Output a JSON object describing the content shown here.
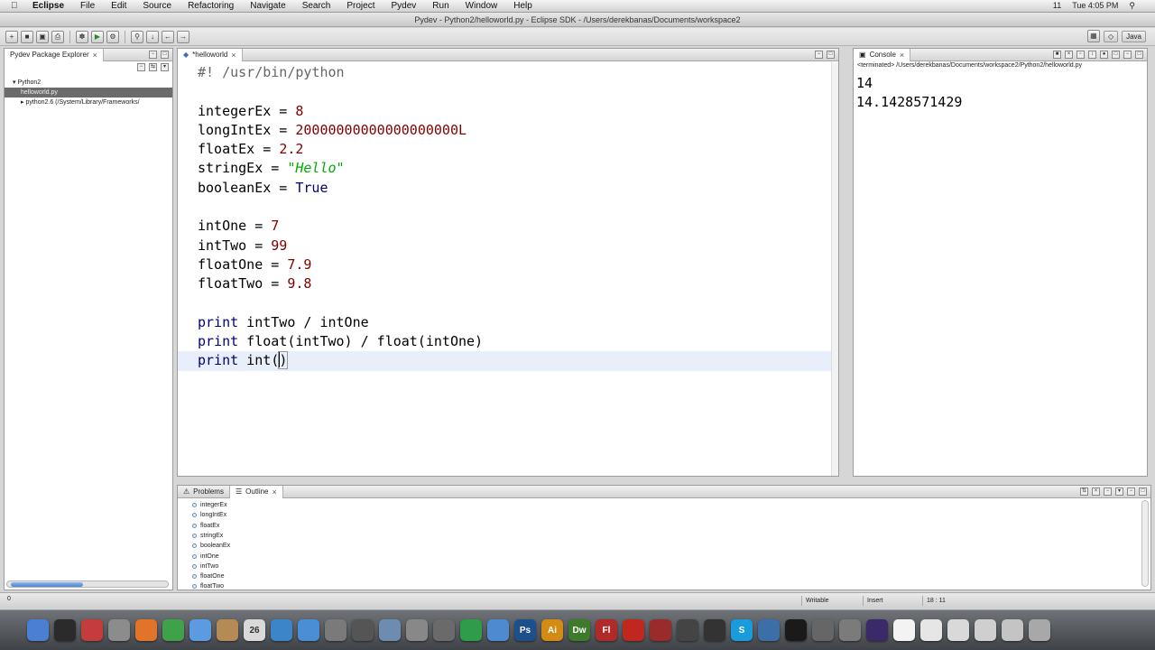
{
  "menubar": {
    "apple": "",
    "items": [
      "Eclipse",
      "File",
      "Edit",
      "Source",
      "Refactoring",
      "Navigate",
      "Search",
      "Project",
      "Pydev",
      "Run",
      "Window",
      "Help"
    ],
    "clock": "Tue 4:05 PM",
    "status_extra": "11"
  },
  "window": {
    "title": "Pydev - Python2/helloworld.py - Eclipse SDK - /Users/derekbanas/Documents/workspace2"
  },
  "toolbar": {
    "perspective_java": "Java"
  },
  "explorer": {
    "tab": "Pydev Package Explorer",
    "items": [
      {
        "label": "Python2",
        "indent": 1,
        "selected": false
      },
      {
        "label": "helloworld.py",
        "indent": 2,
        "selected": true
      },
      {
        "label": "python2.6  (/System/Library/Frameworks/",
        "indent": 2,
        "selected": false
      }
    ]
  },
  "editor": {
    "tab": "*helloworld",
    "lines": [
      {
        "segs": [
          {
            "t": "#! /usr/bin/python",
            "c": "cm"
          }
        ]
      },
      {
        "segs": []
      },
      {
        "segs": [
          {
            "t": "integerEx = ",
            "c": ""
          },
          {
            "t": "8",
            "c": "num"
          }
        ]
      },
      {
        "segs": [
          {
            "t": "longIntEx = ",
            "c": ""
          },
          {
            "t": "20000000000000000000L",
            "c": "num"
          }
        ]
      },
      {
        "segs": [
          {
            "t": "floatEx = ",
            "c": ""
          },
          {
            "t": "2.2",
            "c": "num"
          }
        ]
      },
      {
        "segs": [
          {
            "t": "stringEx = ",
            "c": ""
          },
          {
            "t": "\"Hello\"",
            "c": "str"
          }
        ]
      },
      {
        "segs": [
          {
            "t": "booleanEx = ",
            "c": ""
          },
          {
            "t": "True",
            "c": "kw"
          }
        ]
      },
      {
        "segs": []
      },
      {
        "segs": [
          {
            "t": "intOne = ",
            "c": ""
          },
          {
            "t": "7",
            "c": "num"
          }
        ]
      },
      {
        "segs": [
          {
            "t": "intTwo = ",
            "c": ""
          },
          {
            "t": "99",
            "c": "num"
          }
        ]
      },
      {
        "segs": [
          {
            "t": "floatOne = ",
            "c": ""
          },
          {
            "t": "7.9",
            "c": "num"
          }
        ]
      },
      {
        "segs": [
          {
            "t": "floatTwo = ",
            "c": ""
          },
          {
            "t": "9.8",
            "c": "num"
          }
        ]
      },
      {
        "segs": []
      },
      {
        "segs": [
          {
            "t": "print",
            "c": "kw"
          },
          {
            "t": " intTwo / intOne",
            "c": ""
          }
        ]
      },
      {
        "segs": [
          {
            "t": "print",
            "c": "kw"
          },
          {
            "t": " float(intTwo) / float(intOne)",
            "c": ""
          }
        ]
      },
      {
        "segs": [
          {
            "t": "print",
            "c": "kw"
          },
          {
            "t": " int(",
            "c": ""
          },
          {
            "t": ")",
            "c": "bracket"
          }
        ],
        "current": true
      }
    ]
  },
  "console": {
    "tab": "Console",
    "path": "<terminated> /Users/derekbanas/Documents/workspace2/Python2/helloworld.py",
    "output": [
      "14",
      "14.1428571429"
    ]
  },
  "bottom": {
    "tab_problems": "Problems",
    "tab_outline": "Outline",
    "outline_items": [
      "integerEx",
      "longIntEx",
      "floatEx",
      "stringEx",
      "booleanEx",
      "intOne",
      "intTwo",
      "floatOne",
      "floatTwo"
    ]
  },
  "status": {
    "left": "0",
    "writable": "Writable",
    "insert": "Insert",
    "position": "18 : 11"
  },
  "dock": {
    "apps": [
      {
        "name": "finder",
        "label": "",
        "color": "#4a7fd1"
      },
      {
        "name": "dashboard",
        "label": "",
        "color": "#2b2b2b"
      },
      {
        "name": "calendar-app",
        "label": "",
        "color": "#c43c3c"
      },
      {
        "name": "preferences",
        "label": "",
        "color": "#8c8c8c"
      },
      {
        "name": "firefox",
        "label": "",
        "color": "#e2742a"
      },
      {
        "name": "chrome",
        "label": "",
        "color": "#3fa24a"
      },
      {
        "name": "ichat",
        "label": "",
        "color": "#5d9be0"
      },
      {
        "name": "address-book",
        "label": "",
        "color": "#b48a55"
      },
      {
        "name": "ical",
        "label": "26",
        "color": "#d9d9d9"
      },
      {
        "name": "itunes",
        "label": "",
        "color": "#3d85c9"
      },
      {
        "name": "safari",
        "label": "",
        "color": "#4a8fd6"
      },
      {
        "name": "xcode-tool",
        "label": "",
        "color": "#7a7a7a"
      },
      {
        "name": "instruments",
        "label": "",
        "color": "#555"
      },
      {
        "name": "app-store",
        "label": "",
        "color": "#6d8cb0"
      },
      {
        "name": "system-prefs",
        "label": "",
        "color": "#888"
      },
      {
        "name": "pen-tool",
        "label": "",
        "color": "#6a6a6a"
      },
      {
        "name": "numbers",
        "label": "",
        "color": "#2f9c4a"
      },
      {
        "name": "pages",
        "label": "",
        "color": "#4d8ad0"
      },
      {
        "name": "photoshop",
        "label": "Ps",
        "color": "#1d4f8a"
      },
      {
        "name": "illustrator",
        "label": "Ai",
        "color": "#d28b14"
      },
      {
        "name": "dreamweaver",
        "label": "Dw",
        "color": "#3d7a2a"
      },
      {
        "name": "flash",
        "label": "Fl",
        "color": "#b02a2a"
      },
      {
        "name": "acrobat",
        "label": "",
        "color": "#c0281f"
      },
      {
        "name": "fireworks",
        "label": "",
        "color": "#9a2b2b"
      },
      {
        "name": "soundtrack",
        "label": "",
        "color": "#444"
      },
      {
        "name": "final-cut",
        "label": "",
        "color": "#333"
      },
      {
        "name": "skype",
        "label": "S",
        "color": "#1a9bdc"
      },
      {
        "name": "network",
        "label": "",
        "color": "#3c6ea8"
      },
      {
        "name": "terminal",
        "label": "",
        "color": "#1a1a1a"
      },
      {
        "name": "calculator",
        "label": "",
        "color": "#666"
      },
      {
        "name": "script-editor",
        "label": "",
        "color": "#7b7b7b"
      },
      {
        "name": "eclipse",
        "label": "",
        "color": "#3a2a6a"
      },
      {
        "name": "document1",
        "label": "",
        "color": "#f3f3f3"
      },
      {
        "name": "document2",
        "label": "",
        "color": "#e6e6e6"
      },
      {
        "name": "folder",
        "label": "",
        "color": "#d9d9d9"
      },
      {
        "name": "stack",
        "label": "",
        "color": "#cfcfcf"
      },
      {
        "name": "stack2",
        "label": "",
        "color": "#c4c4c4"
      },
      {
        "name": "trash",
        "label": "",
        "color": "#a8a8a8"
      }
    ]
  }
}
